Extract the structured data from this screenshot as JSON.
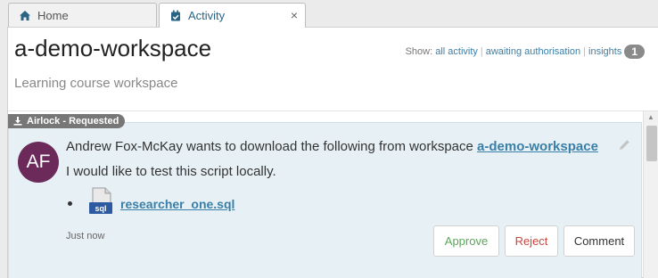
{
  "tabs": [
    {
      "label": "Home",
      "icon": "home-icon"
    },
    {
      "label": "Activity",
      "icon": "calendar-check-icon",
      "close": "×"
    }
  ],
  "workspace": {
    "title": "a-demo-workspace",
    "description": "Learning course workspace"
  },
  "show_filter": {
    "prefix": "Show:",
    "links": [
      "all activity",
      "awaiting authorisation",
      "insights"
    ],
    "count": "1"
  },
  "activity": {
    "label": "Airlock - Requested",
    "avatar_initials": "AF",
    "message_prefix": "Andrew Fox-McKay wants to download the following from workspace ",
    "message_link": "a-demo-workspace",
    "note": "I would like to test this script locally.",
    "file_icon_text": "sql",
    "file_name": "researcher_one.sql",
    "timestamp": "Just now",
    "actions": {
      "approve": "Approve",
      "reject": "Reject",
      "comment": "Comment"
    }
  },
  "colors": {
    "accent_link": "#3a7fa8",
    "avatar_bg": "#6b2a5a",
    "approve": "#5ba55b",
    "reject": "#c9463d",
    "activity_bg": "#e7f1f5"
  }
}
